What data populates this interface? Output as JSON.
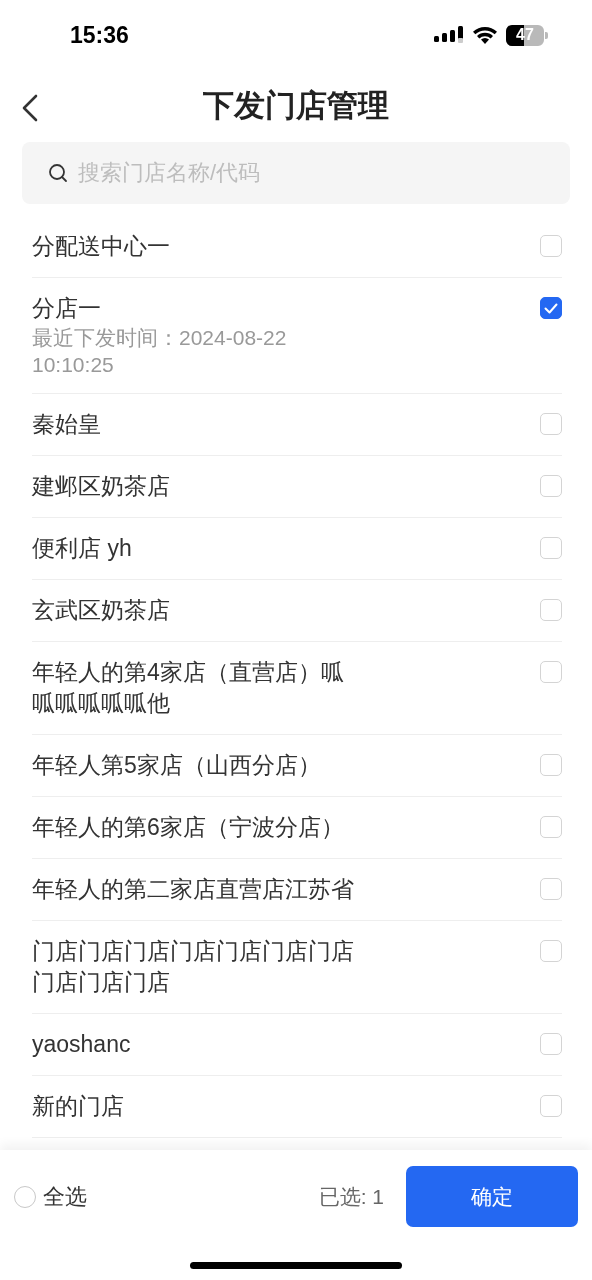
{
  "status_bar": {
    "time": "15:36",
    "battery": "47"
  },
  "header": {
    "title": "下发门店管理"
  },
  "search": {
    "placeholder": "搜索门店名称/代码"
  },
  "stores": [
    {
      "name": "分配送中心一",
      "checked": false
    },
    {
      "name": "分店一",
      "detail": "最近下发时间：2024-08-22 10:10:25",
      "checked": true
    },
    {
      "name": "秦始皇",
      "checked": false
    },
    {
      "name": "建邺区奶茶店",
      "checked": false
    },
    {
      "name": "便利店 yh",
      "checked": false
    },
    {
      "name": "玄武区奶茶店",
      "checked": false
    },
    {
      "name": "年轻人的第4家店（直营店）呱呱呱呱呱呱他",
      "checked": false
    },
    {
      "name": "年轻人第5家店（山西分店）",
      "checked": false
    },
    {
      "name": "年轻人的第6家店（宁波分店）",
      "checked": false
    },
    {
      "name": "年轻人的第二家店直营店江苏省",
      "checked": false
    },
    {
      "name": "门店门店门店门店门店门店门店门店门店门店",
      "checked": false
    },
    {
      "name": "yaoshanc",
      "checked": false
    },
    {
      "name": "新的门店",
      "checked": false
    }
  ],
  "footer": {
    "select_all": {
      "label": "全选",
      "checked": false
    },
    "selected_count": "已选: 1",
    "confirm": "确定"
  }
}
